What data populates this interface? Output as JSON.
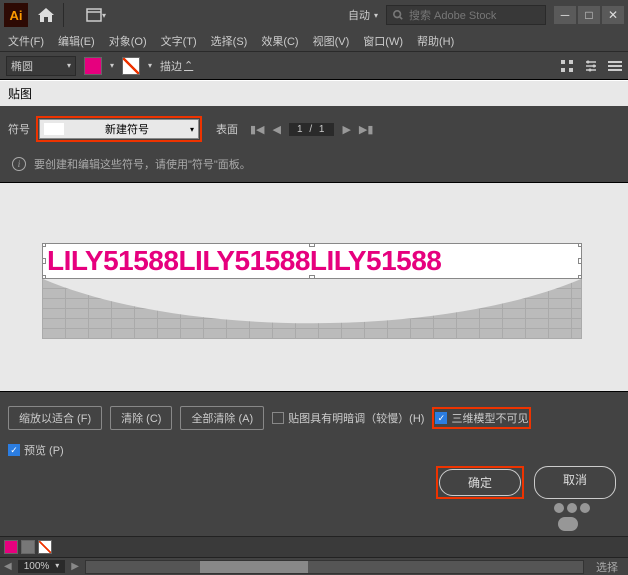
{
  "topbar": {
    "logo": "Ai",
    "auto_label": "自动",
    "search_placeholder": "搜索 Adobe Stock"
  },
  "menu": {
    "file": "文件(F)",
    "edit": "编辑(E)",
    "object": "对象(O)",
    "type": "文字(T)",
    "select": "选择(S)",
    "effect": "效果(C)",
    "view": "视图(V)",
    "window": "窗口(W)",
    "help": "帮助(H)"
  },
  "toolbar": {
    "shape": "椭圆",
    "stroke_label": "描边"
  },
  "panel": {
    "title": "贴图"
  },
  "symbol": {
    "label": "符号",
    "selected": "新建符号",
    "surface_label": "表面",
    "page_indicator": "1 / 1"
  },
  "info": {
    "text": "要创建和编辑这些符号，请使用\"符号\"面板。"
  },
  "art": {
    "text": "LILY51588LILY51588LILY51588"
  },
  "buttons": {
    "scale_to_fit": "缩放以适合 (F)",
    "clear": "清除 (C)",
    "clear_all": "全部清除 (A)",
    "shade_label": "贴图具有明暗调（较慢）(H)",
    "invisible_label": "三维模型不可见",
    "preview": "预览 (P)",
    "ok": "确定",
    "cancel": "取消"
  },
  "footer": {
    "zoom": "100%",
    "selection_label": "选择"
  }
}
